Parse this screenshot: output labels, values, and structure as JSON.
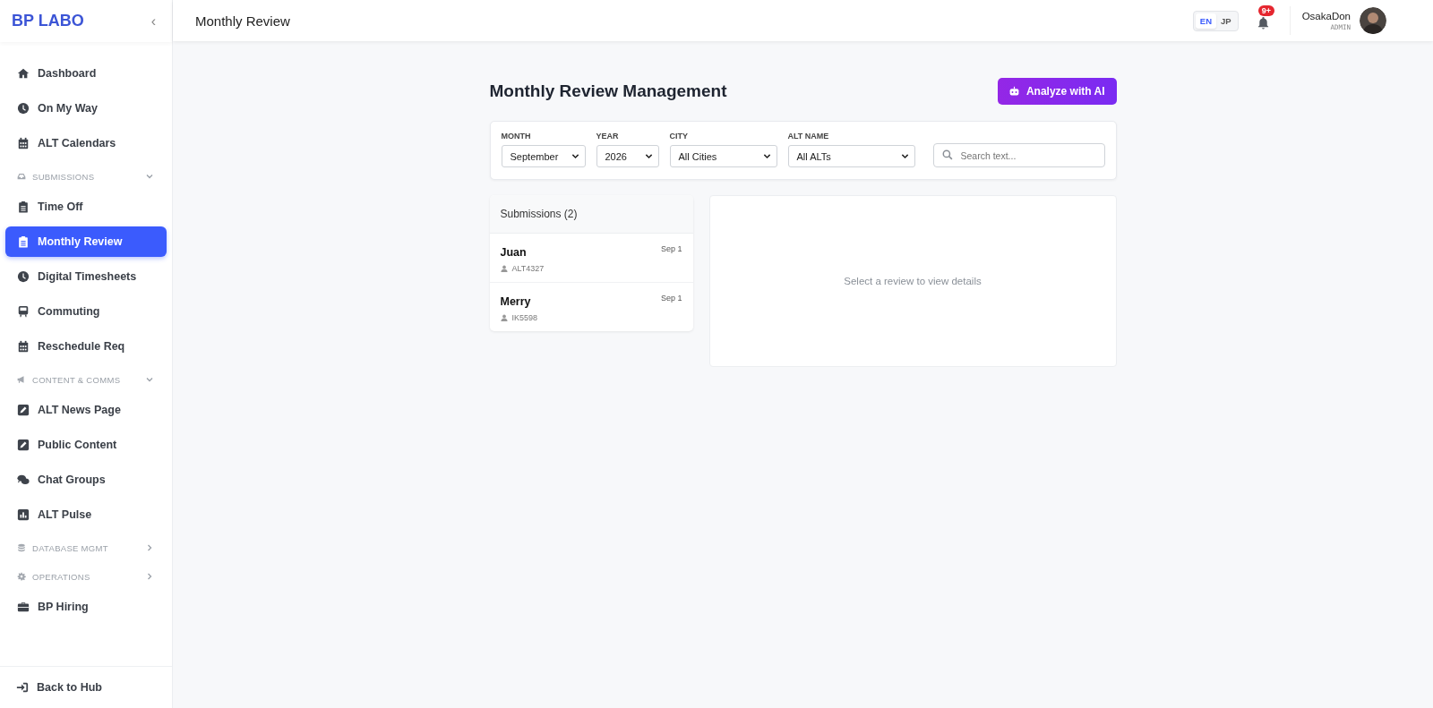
{
  "sidebar": {
    "logo": "BP LABO",
    "collapse_icon": "‹",
    "items": [
      {
        "kind": "link",
        "label": "Dashboard",
        "selected": false
      },
      {
        "kind": "link",
        "label": "On My Way",
        "selected": false
      },
      {
        "kind": "link",
        "label": "ALT Calendars",
        "selected": false
      },
      {
        "kind": "section",
        "label": "SUBMISSIONS",
        "expanded": true
      },
      {
        "kind": "link",
        "label": "Time Off",
        "selected": false
      },
      {
        "kind": "link",
        "label": "Monthly Review",
        "selected": true
      },
      {
        "kind": "link",
        "label": "Digital Timesheets",
        "selected": false
      },
      {
        "kind": "link",
        "label": "Commuting",
        "selected": false
      },
      {
        "kind": "link",
        "label": "Reschedule Req",
        "selected": false
      },
      {
        "kind": "section",
        "label": "CONTENT & COMMS",
        "expanded": true
      },
      {
        "kind": "link",
        "label": "ALT News Page",
        "selected": false
      },
      {
        "kind": "link",
        "label": "Public Content",
        "selected": false
      },
      {
        "kind": "link",
        "label": "Chat Groups",
        "selected": false
      },
      {
        "kind": "link",
        "label": "ALT Pulse",
        "selected": false
      },
      {
        "kind": "section",
        "label": "DATABASE MGMT",
        "expanded": false
      },
      {
        "kind": "section",
        "label": "OPERATIONS",
        "expanded": false
      },
      {
        "kind": "link",
        "label": "BP Hiring",
        "selected": false
      }
    ],
    "footer": "Back to Hub"
  },
  "header": {
    "title": "Monthly Review",
    "languages": [
      {
        "label": "EN",
        "selected": true
      },
      {
        "label": "JP",
        "selected": false
      }
    ],
    "notification_badge": "9+",
    "user": {
      "name": "OsakaDon",
      "role": "ADMIN"
    }
  },
  "page": {
    "title": "Monthly Review Management",
    "action_button": "Analyze with AI",
    "filters": [
      {
        "label": "MONTH",
        "value": "September"
      },
      {
        "label": "YEAR",
        "value": "2026"
      },
      {
        "label": "CITY",
        "value": "All Cities"
      },
      {
        "label": "ALT NAME",
        "value": "All ALTs"
      }
    ],
    "search": {
      "placeholder": "Search text..."
    },
    "submissions": {
      "title": "Submissions (2)",
      "items": [
        {
          "name": "Juan",
          "id": "ALT4327",
          "date": "Sep 1",
          "selected": false
        },
        {
          "name": "Merry",
          "id": "IK5598",
          "date": "Sep 1",
          "selected": false
        }
      ]
    },
    "detail_placeholder": "Select a review to view details"
  }
}
